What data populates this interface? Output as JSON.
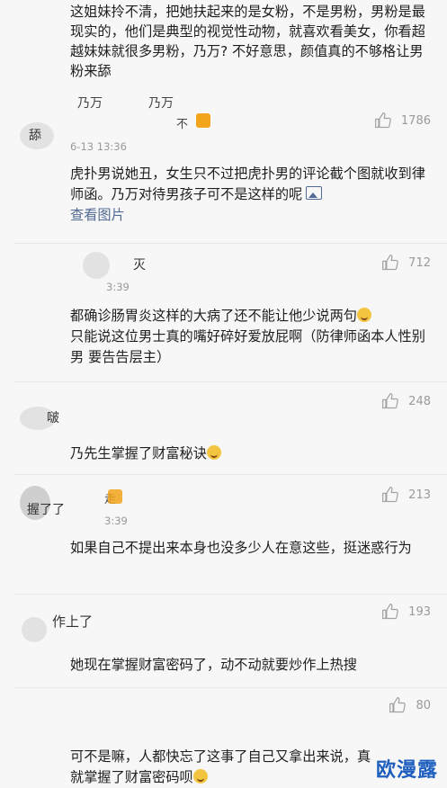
{
  "intro": {
    "text": "这姐妹拎不清，把她扶起来的是女粉，不是男粉，男粉是最现实的，他们是典型的视觉性动物，就喜欢看美女，你看超越妹妹就很多男粉，乃万? 不好意思，颜值真的不够格让男粉来舔"
  },
  "comments": [
    {
      "username": "乃万",
      "username_fragment": "舔",
      "quote": "乃万",
      "badge_fragment": "不",
      "time": "6-13 13:36",
      "text": "虎扑男说她丑，女生只不过把虎扑男的评论截个图就收到律师函。乃万对待男孩子可不是这样的呢",
      "link": "查看图片",
      "likes": "1786"
    },
    {
      "username": "灭",
      "time_fragment": "3:39",
      "text": "都确诊肠胃炎这样的大病了还不能让他少说两句",
      "text2": "只能说这位男士真的嘴好碎好爱放屁啊（防律师函本人性别男 要告告层主）",
      "likes": "712"
    },
    {
      "username": "啵",
      "text": "乃先生掌握了财富秘诀",
      "likes": "248"
    },
    {
      "username": "握了了",
      "username_fragment": "走",
      "time_fragment": "3:39",
      "text": "如果自己不提出来本身也没多少人在意这些，挺迷惑行为",
      "likes": "213"
    },
    {
      "username": "作上了",
      "text": "她现在掌握财富密码了，动不动就要炒作上热搜",
      "likes": "193"
    },
    {
      "likes": "80",
      "text": "可不是嘛，人都快忘了这事了自己又拿出来说，真就掌握了财富密码呗"
    }
  ],
  "watermark": "欧漫露"
}
